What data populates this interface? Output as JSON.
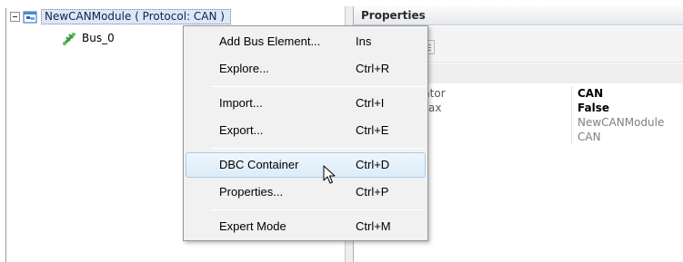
{
  "tree": {
    "root": {
      "label": "NewCANModule ( Protocol: CAN )",
      "icon": "module-icon"
    },
    "children": [
      {
        "label": "Bus_0",
        "icon": "bus-icon"
      }
    ]
  },
  "properties": {
    "title": "Properties",
    "rows": [
      {
        "name": "erator",
        "value": "CAN",
        "style": "bold"
      },
      {
        "name": "nMax",
        "value": "False",
        "style": "bold"
      },
      {
        "name": "",
        "value": "NewCANModule",
        "style": "gray"
      },
      {
        "name": "",
        "value": "CAN",
        "style": "gray"
      }
    ]
  },
  "context_menu": {
    "items": [
      {
        "label": "Add Bus Element...",
        "shortcut": "Ins"
      },
      {
        "label": "Explore...",
        "shortcut": "Ctrl+R"
      },
      {
        "label": "Import...",
        "shortcut": "Ctrl+I"
      },
      {
        "label": "Export...",
        "shortcut": "Ctrl+E"
      },
      {
        "label": "DBC Container",
        "shortcut": "Ctrl+D",
        "highlighted": true
      },
      {
        "label": "Properties...",
        "shortcut": "Ctrl+P"
      },
      {
        "label": "Expert Mode",
        "shortcut": "Ctrl+M"
      }
    ]
  },
  "colors": {
    "selection_bg": "#dde7f6",
    "menu_highlight": "#dcecfa",
    "menu_bg": "#f1f1f1"
  }
}
